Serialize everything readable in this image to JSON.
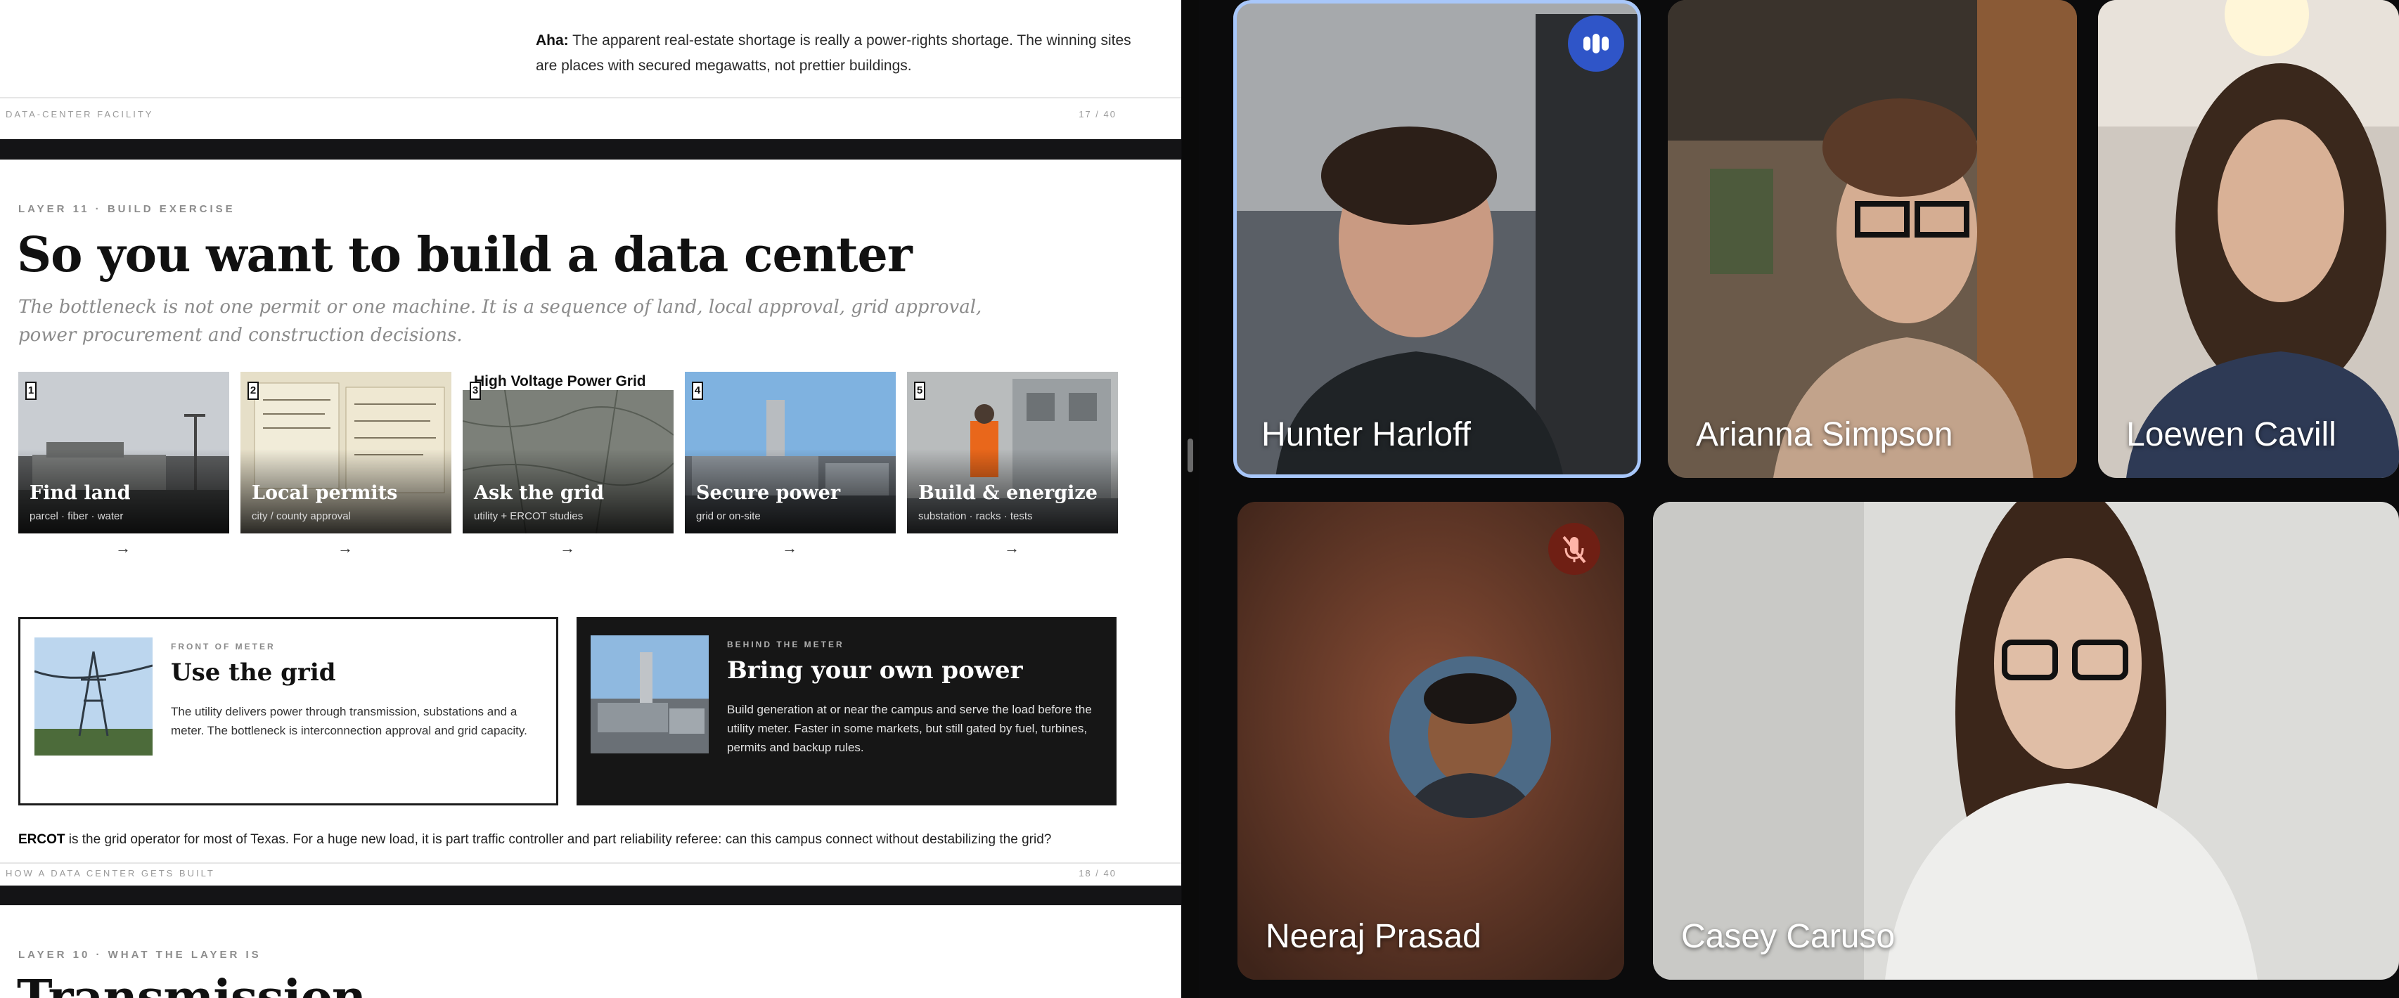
{
  "presentation": {
    "slide_top": {
      "aha_label": "Aha:",
      "aha_text": " The apparent real-estate shortage is really a power-rights shortage. The winning sites are places with secured megawatts, not prettier buildings.",
      "footer_left": "DATA-CENTER FACILITY",
      "footer_right": "17 / 40"
    },
    "slide_main": {
      "eyebrow": "LAYER 11 · BUILD EXERCISE",
      "title": "So you want to build a data center",
      "subtitle": "The bottleneck is not one permit or one machine. It is a sequence of land, local approval, grid approval, power procurement and construction decisions.",
      "steps": [
        {
          "num": "1",
          "name": "Find land",
          "sub": "parcel · fiber · water"
        },
        {
          "num": "2",
          "name": "Local permits",
          "sub": "city / county approval"
        },
        {
          "num": "3",
          "name": "Ask the grid",
          "sub": "utility + ERCOT studies",
          "photo_title": "High Voltage Power Grid"
        },
        {
          "num": "4",
          "name": "Secure power",
          "sub": "grid or on-site"
        },
        {
          "num": "5",
          "name": "Build & energize",
          "sub": "substation · racks · tests"
        }
      ],
      "arrow": "→",
      "option_front": {
        "tag": "FRONT OF METER",
        "title": "Use the grid",
        "body": "The utility delivers power through transmission, substations and a meter. The bottleneck is interconnection approval and grid capacity."
      },
      "option_behind": {
        "tag": "BEHIND THE METER",
        "title": "Bring your own power",
        "body": "Build generation at or near the campus and serve the load before the utility meter. Faster in some markets, but still gated by fuel, turbines, permits and backup rules."
      },
      "ercot_label": "ERCOT",
      "ercot_text": " is the grid operator for most of Texas. For a huge new load, it is part traffic controller and part reliability referee: can this campus connect without destabilizing the grid?",
      "footer_left": "HOW A DATA CENTER GETS BUILT",
      "footer_right": "18 / 40"
    },
    "slide_next": {
      "eyebrow": "LAYER 10 · WHAT THE LAYER IS",
      "title": "Transmission"
    }
  },
  "meeting": {
    "participants": [
      {
        "name": "Hunter Harloff",
        "state": "speaking"
      },
      {
        "name": "Arianna Simpson"
      },
      {
        "name": "Loewen Cavill"
      },
      {
        "name": "Neeraj Prasad",
        "state": "muted"
      },
      {
        "name": "Casey Caruso"
      }
    ]
  },
  "icons": {
    "speaking": "audio-level-icon",
    "muted": "mic-off-icon"
  },
  "colors": {
    "active_speaker_ring": "#a8c7fa",
    "speaking_badge": "#2f55c8",
    "muted_badge": "#6f1f14"
  }
}
